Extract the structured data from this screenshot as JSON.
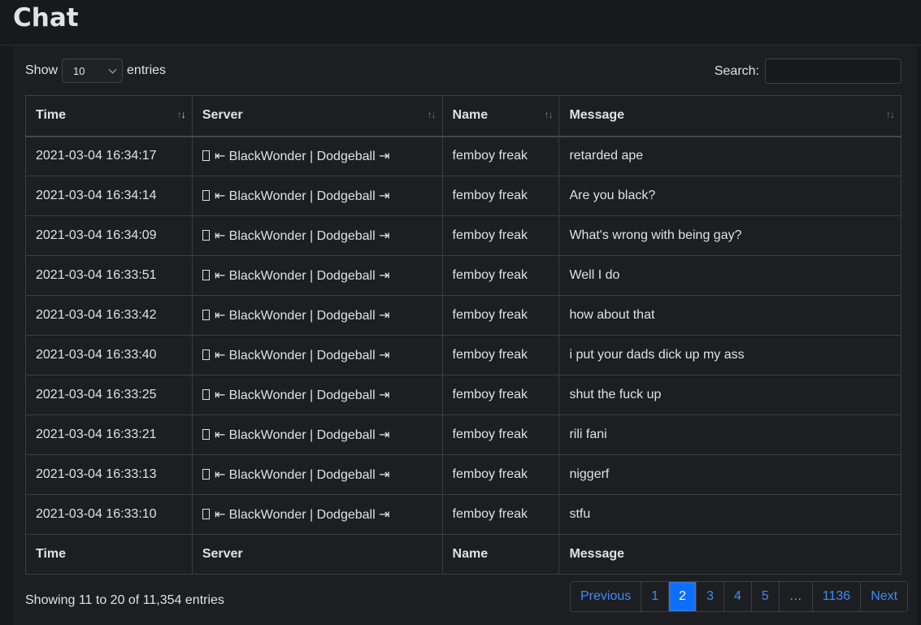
{
  "title": "Chat",
  "controls": {
    "show_label": "Show",
    "entries_label": "entries",
    "length_value": "10",
    "search_label": "Search:",
    "search_value": ""
  },
  "table": {
    "headers": [
      "Time",
      "Server",
      "Name",
      "Message"
    ],
    "rows": [
      {
        "time": "2021-03-04 16:34:17",
        "server": "⇤ BlackWonder | Dodgeball ⇥",
        "name": "femboy freak",
        "message": "retarded ape"
      },
      {
        "time": "2021-03-04 16:34:14",
        "server": "⇤ BlackWonder | Dodgeball ⇥",
        "name": "femboy freak",
        "message": "Are you black?"
      },
      {
        "time": "2021-03-04 16:34:09",
        "server": "⇤ BlackWonder | Dodgeball ⇥",
        "name": "femboy freak",
        "message": "What's wrong with being gay?"
      },
      {
        "time": "2021-03-04 16:33:51",
        "server": "⇤ BlackWonder | Dodgeball ⇥",
        "name": "femboy freak",
        "message": "Well I do"
      },
      {
        "time": "2021-03-04 16:33:42",
        "server": "⇤ BlackWonder | Dodgeball ⇥",
        "name": "femboy freak",
        "message": "how about that"
      },
      {
        "time": "2021-03-04 16:33:40",
        "server": "⇤ BlackWonder | Dodgeball ⇥",
        "name": "femboy freak",
        "message": "i put your dads dick up my ass"
      },
      {
        "time": "2021-03-04 16:33:25",
        "server": "⇤ BlackWonder | Dodgeball ⇥",
        "name": "femboy freak",
        "message": "shut the fuck up"
      },
      {
        "time": "2021-03-04 16:33:21",
        "server": "⇤ BlackWonder | Dodgeball ⇥",
        "name": "femboy freak",
        "message": "rili fani"
      },
      {
        "time": "2021-03-04 16:33:13",
        "server": "⇤ BlackWonder | Dodgeball ⇥",
        "name": "femboy freak",
        "message": "niggerf"
      },
      {
        "time": "2021-03-04 16:33:10",
        "server": "⇤ BlackWonder | Dodgeball ⇥",
        "name": "femboy freak",
        "message": "stfu"
      }
    ]
  },
  "info_text": "Showing 11 to 20 of 11,354 entries",
  "pagination": {
    "previous": "Previous",
    "pages": [
      "1",
      "2",
      "3",
      "4",
      "5",
      "…",
      "1136"
    ],
    "active_page": "2",
    "next": "Next"
  },
  "colors": {
    "background": "#18191b",
    "accent": "#0d6efd",
    "link": "#3d8bfd"
  }
}
